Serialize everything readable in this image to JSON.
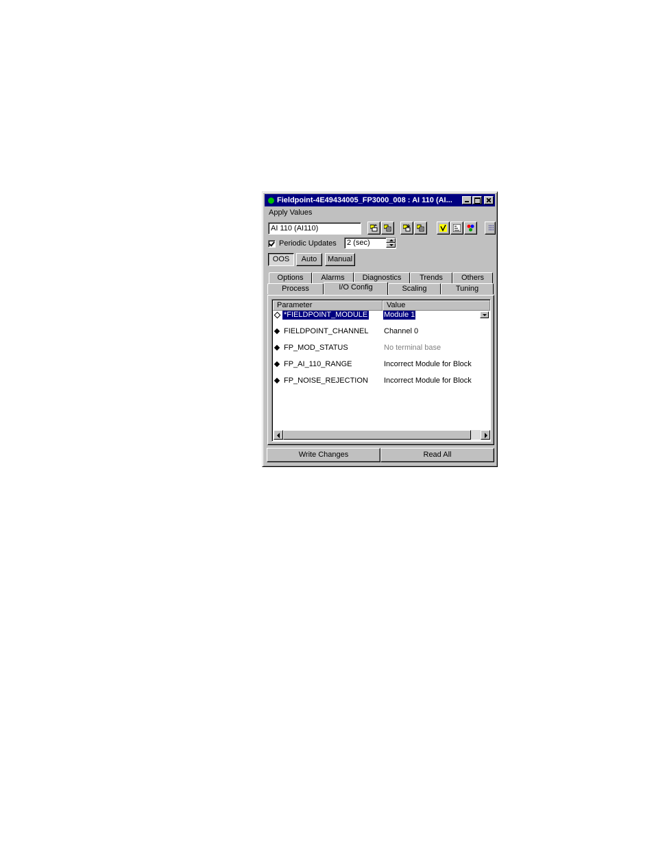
{
  "window": {
    "title": "Fieldpoint-4E49434005_FP3000_008 : AI 110 (AI...",
    "status_color": "#00c000"
  },
  "menubar": {
    "apply_values": "Apply Values"
  },
  "toolbar": {
    "block_selector_value": "AI 110 (AI110)",
    "icons": [
      "write-icon",
      "write-all-icon",
      "read-icon",
      "read-all-icon",
      "check-icon",
      "sort-icon",
      "colors-icon",
      "options-icon"
    ]
  },
  "periodic": {
    "label": "Periodic Updates",
    "checked": true,
    "interval": "2 (sec)"
  },
  "modes": {
    "oos": "OOS",
    "auto": "Auto",
    "manual": "Manual"
  },
  "tabs": {
    "back_row": [
      "Options",
      "Alarms",
      "Diagnostics",
      "Trends",
      "Others"
    ],
    "front_row": [
      "Process",
      "I/O Config",
      "Scaling",
      "Tuning"
    ],
    "active": "I/O Config"
  },
  "grid": {
    "headers": {
      "parameter": "Parameter",
      "value": "Value"
    },
    "rows": [
      {
        "parameter": "*FIELDPOINT_MODULE",
        "value": "Module 1",
        "selected": true
      },
      {
        "parameter": "FIELDPOINT_CHANNEL",
        "value": "Channel 0"
      },
      {
        "parameter": "FP_MOD_STATUS",
        "value": "No terminal base"
      },
      {
        "parameter": "FP_AI_110_RANGE",
        "value": "Incorrect Module for Block"
      },
      {
        "parameter": "FP_NOISE_REJECTION",
        "value": "Incorrect Module for Block"
      }
    ]
  },
  "buttons": {
    "write_changes": "Write Changes",
    "read_all": "Read All"
  }
}
